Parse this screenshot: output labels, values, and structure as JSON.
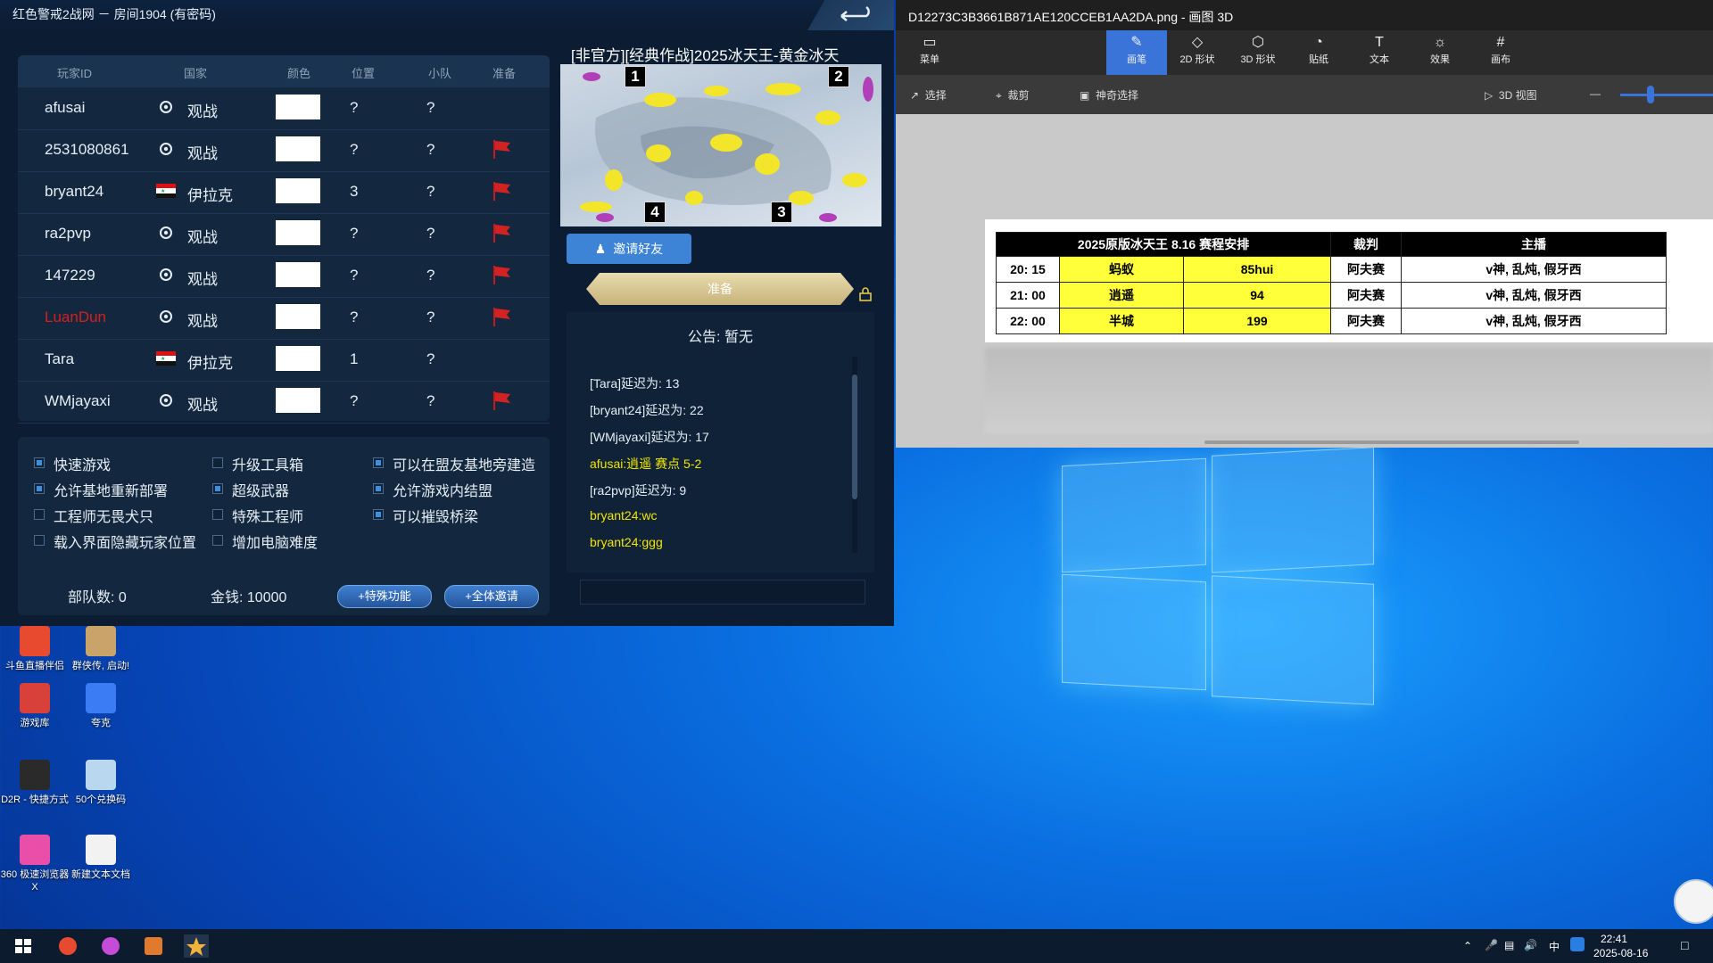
{
  "lobby": {
    "title": "红色警戒2战网 － 房间1904 (有密码)",
    "columns": [
      "玩家ID",
      "国家",
      "颜色",
      "位置",
      "小队",
      "准备"
    ],
    "players": [
      {
        "id": "afusai",
        "nation": "观战",
        "position": "?",
        "team": "?",
        "ready": false,
        "id_color": "#e6edf5",
        "flag": "spectator"
      },
      {
        "id": "2531080861",
        "nation": "观战",
        "position": "?",
        "team": "?",
        "ready": true,
        "id_color": "#e6edf5",
        "flag": "spectator"
      },
      {
        "id": "bryant24",
        "nation": "伊拉克",
        "position": "3",
        "team": "?",
        "ready": true,
        "id_color": "#e6edf5",
        "flag": "iraq"
      },
      {
        "id": "ra2pvp",
        "nation": "观战",
        "position": "?",
        "team": "?",
        "ready": true,
        "id_color": "#e6edf5",
        "flag": "spectator"
      },
      {
        "id": "147229",
        "nation": "观战",
        "position": "?",
        "team": "?",
        "ready": true,
        "id_color": "#e6edf5",
        "flag": "spectator"
      },
      {
        "id": "LuanDun",
        "nation": "观战",
        "position": "?",
        "team": "?",
        "ready": true,
        "id_color": "#d42020",
        "flag": "spectator"
      },
      {
        "id": "Tara",
        "nation": "伊拉克",
        "position": "1",
        "team": "?",
        "ready": false,
        "id_color": "#e6edf5",
        "flag": "iraq"
      },
      {
        "id": "WMjayaxi",
        "nation": "观战",
        "position": "?",
        "team": "?",
        "ready": true,
        "id_color": "#e6edf5",
        "flag": "spectator"
      }
    ],
    "options": [
      {
        "label": "快速游戏",
        "checked": true
      },
      {
        "label": "升级工具箱",
        "checked": false
      },
      {
        "label": "可以在盟友基地旁建造",
        "checked": true
      },
      {
        "label": "允许基地重新部署",
        "checked": true
      },
      {
        "label": "超级武器",
        "checked": true
      },
      {
        "label": "允许游戏内结盟",
        "checked": true
      },
      {
        "label": "工程师无畏犬只",
        "checked": false
      },
      {
        "label": "特殊工程师",
        "checked": false
      },
      {
        "label": "可以摧毁桥梁",
        "checked": true
      },
      {
        "label": "载入界面隐藏玩家位置",
        "checked": false
      },
      {
        "label": "增加电脑难度",
        "checked": false
      }
    ],
    "units_label": "部队数: 0",
    "money_label": "金钱: 10000",
    "special_button": "+特殊功能",
    "invite_all_button": "+全体邀请",
    "map_title": "[非官方][经典作战]2025冰天王-黄金冰天",
    "map_slots": [
      "1",
      "2",
      "4",
      "3"
    ],
    "invite_friend_button": "邀请好友",
    "ready_button": "准备",
    "announcement": "公告: 暂无",
    "chat": [
      {
        "text": "[Tara]延迟为: 13",
        "color": "#e6edf5"
      },
      {
        "text": "[bryant24]延迟为: 22",
        "color": "#e6edf5"
      },
      {
        "text": "[WMjayaxi]延迟为: 17",
        "color": "#e6edf5"
      },
      {
        "text": "afusai:逍遥 赛点 5-2",
        "color": "#f2e600"
      },
      {
        "text": "[ra2pvp]延迟为: 9",
        "color": "#e6edf5"
      },
      {
        "text": "bryant24:wc",
        "color": "#f2e600"
      },
      {
        "text": "bryant24:ggg",
        "color": "#f2e600"
      }
    ]
  },
  "paint": {
    "title": "D12273C3B3661B871AE120CCEB1AA2DA.png - 画图 3D",
    "ribbon": [
      {
        "label": "菜单",
        "icon": "folder-icon",
        "glyph": "▭"
      },
      {
        "label": "画笔",
        "icon": "brush-icon",
        "glyph": "✎",
        "active": true
      },
      {
        "label": "2D 形状",
        "icon": "shapes-2d-icon",
        "glyph": "◇"
      },
      {
        "label": "3D 形状",
        "icon": "shapes-3d-icon",
        "glyph": "⬡"
      },
      {
        "label": "贴纸",
        "icon": "sticker-icon",
        "glyph": "◔"
      },
      {
        "label": "文本",
        "icon": "text-icon",
        "glyph": "T"
      },
      {
        "label": "效果",
        "icon": "effects-icon",
        "glyph": "☼"
      },
      {
        "label": "画布",
        "icon": "canvas-icon",
        "glyph": "#"
      }
    ],
    "tools": {
      "select": "选择",
      "crop": "裁剪",
      "magic_select": "神奇选择",
      "view3d": "3D 视图",
      "zoom_minus": "—"
    },
    "schedule": {
      "title": "2025原版冰天王 8.16 赛程安排",
      "col_referee": "裁判",
      "col_caster": "主播",
      "rows": [
        {
          "time": "20: 15",
          "p1": "蚂蚁",
          "p2": "85hui",
          "referee": "阿夫赛",
          "casters": "v神, 乱炖, 假牙西"
        },
        {
          "time": "21: 00",
          "p1": "逍遥",
          "p2": "94",
          "referee": "阿夫赛",
          "casters": "v神, 乱炖, 假牙西"
        },
        {
          "time": "22: 00",
          "p1": "半城",
          "p2": "199",
          "referee": "阿夫赛",
          "casters": "v神, 乱炖, 假牙西"
        }
      ]
    }
  },
  "desktop": {
    "icons": [
      {
        "label": "斗鱼直播伴侣",
        "color": "#e84a2f"
      },
      {
        "label": "群侠传, 启动!",
        "color": "#c9a36a"
      },
      {
        "label": "游戏库",
        "color": "#d8413a"
      },
      {
        "label": "夸克",
        "color": "#3b7cf5"
      },
      {
        "label": "D2R - 快捷方式",
        "color": "#2a2a2a"
      },
      {
        "label": "50个兑换码",
        "color": "#b9d7ee"
      },
      {
        "label": "360 极速浏览器X",
        "color": "#e94fa8"
      },
      {
        "label": "新建文本文档",
        "color": "#f2f2f2"
      }
    ]
  },
  "taskbar": {
    "time": "22:41",
    "date": "2025-08-16",
    "ime": "中"
  }
}
